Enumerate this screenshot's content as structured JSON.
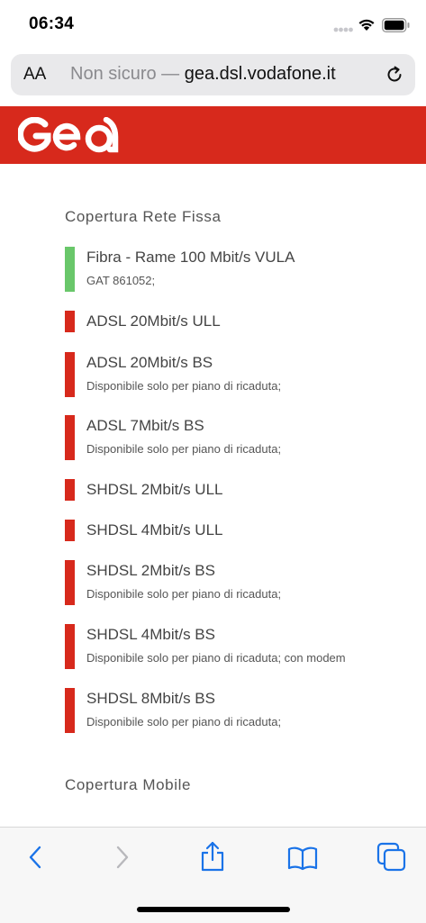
{
  "status_bar": {
    "time": "06:34"
  },
  "url_bar": {
    "text_size_label": "AA",
    "security_label": "Non sicuro —",
    "domain": "gea.dsl.vodafone.it"
  },
  "brand": {
    "logo_text": "Gea"
  },
  "sections": [
    {
      "title": "Copertura Rete Fissa"
    },
    {
      "title": "Copertura Mobile"
    }
  ],
  "services": [
    {
      "name": "Fibra - Rame 100 Mbit/s VULA",
      "note": "GAT 861052;",
      "status": "available",
      "color": "#69c76a"
    },
    {
      "name": "ADSL 20Mbit/s ULL",
      "note": "",
      "status": "unavailable",
      "color": "#d7291c"
    },
    {
      "name": "ADSL 20Mbit/s BS",
      "note": "Disponibile solo per piano di ricaduta;",
      "status": "unavailable",
      "color": "#d7291c"
    },
    {
      "name": "ADSL 7Mbit/s BS",
      "note": "Disponibile solo per piano di ricaduta;",
      "status": "unavailable",
      "color": "#d7291c"
    },
    {
      "name": "SHDSL 2Mbit/s ULL",
      "note": "",
      "status": "unavailable",
      "color": "#d7291c"
    },
    {
      "name": "SHDSL 4Mbit/s ULL",
      "note": "",
      "status": "unavailable",
      "color": "#d7291c"
    },
    {
      "name": "SHDSL 2Mbit/s BS",
      "note": "Disponibile solo per piano di ricaduta;",
      "status": "unavailable",
      "color": "#d7291c"
    },
    {
      "name": "SHDSL 4Mbit/s BS",
      "note": "Disponibile solo per piano di ricaduta; con modem",
      "status": "unavailable",
      "color": "#d7291c"
    },
    {
      "name": "SHDSL 8Mbit/s BS",
      "note": "Disponibile solo per piano di ricaduta;",
      "status": "unavailable",
      "color": "#d7291c"
    }
  ],
  "toolbar": {
    "icons": [
      "back-icon",
      "forward-icon",
      "share-icon",
      "bookmarks-icon",
      "tabs-icon"
    ],
    "accent_color": "#1a73e8"
  }
}
